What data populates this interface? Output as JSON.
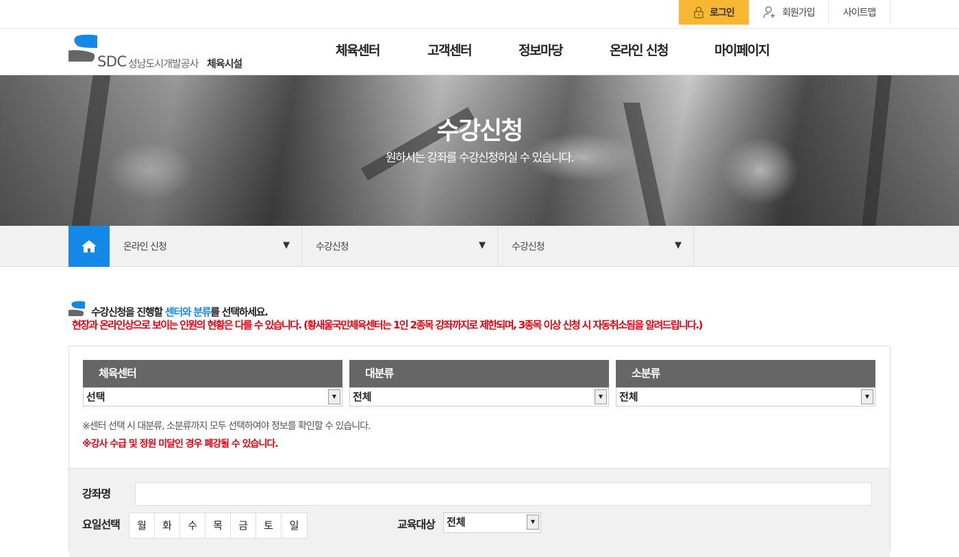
{
  "util": {
    "login": "로그인",
    "join": "회원가입",
    "sitemap": "사이트맵"
  },
  "logo": {
    "sdc": "SDC",
    "org": "성남도시개발공사",
    "sub": "체육시설"
  },
  "gnb": [
    "체육센터",
    "고객센터",
    "정보마당",
    "온라인 신청",
    "마이페이지"
  ],
  "hero": {
    "title": "수강신청",
    "desc": "원하시는 강좌를 수강신청하실 수 있습니다."
  },
  "location": [
    "온라인 신청",
    "수강신청",
    "수강신청"
  ],
  "guide": {
    "line1_pre": "수강신청을 진행할 ",
    "line1_hl": "센터와 분류",
    "line1_post": "를 선택하세요.",
    "line2": "현장과 온라인상으로 보이는 인원의 현황은 다를 수 있습니다. (황새울국민체육센터는 1인 2종목 강좌까지로 제한되며, 3종목 이상 신청 시 자동취소됨을 알려드립니다.)"
  },
  "filters": [
    {
      "head": "체육센터",
      "value": "선택"
    },
    {
      "head": "대분류",
      "value": "전체"
    },
    {
      "head": "소분류",
      "value": "전체"
    }
  ],
  "notes": {
    "n1": "※센터 선택 시 대분류, 소분류까지 모두 선택하여야 정보를 확인할 수 있습니다.",
    "n2": "※강사 수급 및 정원 미달인 경우 폐강될 수 있습니다."
  },
  "search": {
    "course_label": "강좌명",
    "course_value": "",
    "day_label": "요일선택",
    "days": [
      "월",
      "화",
      "수",
      "목",
      "금",
      "토",
      "일"
    ],
    "target_label": "교육대상",
    "target_value": "전체"
  },
  "colors": {
    "accent": "#1488e6",
    "login_bg": "#f7b733",
    "warning": "#e60012",
    "table_head": "#666666"
  }
}
